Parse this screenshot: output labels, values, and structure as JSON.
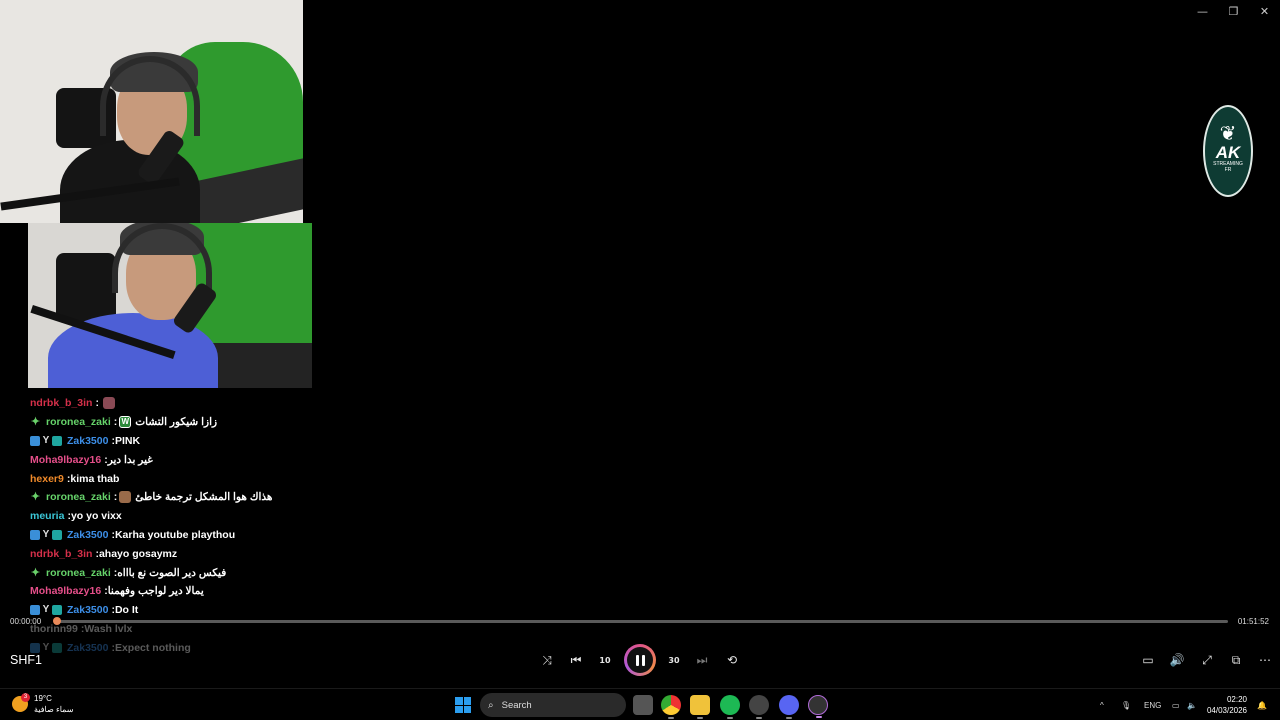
{
  "window": {
    "controls": [
      "—",
      "❐",
      "✕"
    ]
  },
  "logo": {
    "text": "AK",
    "subtext": "STREAMING\nFR"
  },
  "chat": {
    "messages": [
      {
        "user": "ndrbk_b_3in",
        "color": "#d6304a",
        "badges": [],
        "text": "",
        "emote": "pink",
        "faded": false
      },
      {
        "user": "roronea_zaki",
        "color": "#66d36a",
        "badges": [
          "star"
        ],
        "text": "زازا شيكور التشات",
        "emote": "w",
        "faded": false
      },
      {
        "user": "Zak3500",
        "color": "#3d8fe8",
        "badges": [
          "blue",
          "y",
          "cyan"
        ],
        "text": "PINK",
        "emote": "",
        "faded": false
      },
      {
        "user": "Moha9lbazy16",
        "color": "#e64f8a",
        "badges": [],
        "text": "غير بدا دير",
        "emote": "",
        "faded": false
      },
      {
        "user": "hexer9",
        "color": "#f08a2a",
        "badges": [],
        "text": "kima thab",
        "emote": "",
        "faded": false
      },
      {
        "user": "roronea_zaki",
        "color": "#66d36a",
        "badges": [
          "star"
        ],
        "text": "هذاك هوا المشكل ترجمة خاطئ",
        "emote": "cat",
        "faded": false
      },
      {
        "user": "meuria",
        "color": "#3bc6d6",
        "badges": [],
        "text": "yo yo vixx",
        "emote": "",
        "faded": false
      },
      {
        "user": "Zak3500",
        "color": "#3d8fe8",
        "badges": [
          "blue",
          "y",
          "cyan"
        ],
        "text": "Karha youtube playthou",
        "emote": "",
        "faded": false
      },
      {
        "user": "ndrbk_b_3in",
        "color": "#d6304a",
        "badges": [],
        "text": "ahayo gosaymz",
        "emote": "",
        "faded": false
      },
      {
        "user": "roronea_zaki",
        "color": "#66d36a",
        "badges": [
          "star"
        ],
        "text": "فيكس دير الصوت نع باااه",
        "emote": "",
        "faded": false
      },
      {
        "user": "Moha9lbazy16",
        "color": "#e64f8a",
        "badges": [],
        "text": "يمالا دير لواجب وفهمنا",
        "emote": "",
        "faded": false
      },
      {
        "user": "Zak3500",
        "color": "#3d8fe8",
        "badges": [
          "blue",
          "y",
          "cyan"
        ],
        "text": "Do It",
        "emote": "",
        "faded": false
      },
      {
        "user": "thorinn99",
        "color": "#ffffff",
        "badges": [],
        "text": "Wash lvlx",
        "emote": "",
        "faded": true
      },
      {
        "user": "Zak3500",
        "color": "#3d8fe8",
        "badges": [
          "blue",
          "y",
          "cyan"
        ],
        "text": "Expect nothing",
        "emote": "",
        "faded": true
      }
    ]
  },
  "player": {
    "current_time": "00:00:00",
    "total_time": "01:51:52",
    "progress": 0.002,
    "title": "SHF1",
    "controls": {
      "shuffle": "⤨",
      "previous": "⏮",
      "rewind": "10",
      "forward": "30",
      "next": "⏭",
      "repeat": "⟲"
    },
    "right_controls": {
      "subtitles": "▭",
      "volume": "🔊",
      "fullscreen": "⤢",
      "miniplayer": "⧉",
      "more": "⋯"
    }
  },
  "taskbar": {
    "weather": {
      "temp": "19°C",
      "desc": "سماء صافية",
      "badge": "3"
    },
    "search_placeholder": "Search",
    "tray": {
      "chevron": "^",
      "mic": "🎙",
      "lang": "ENG"
    },
    "clock": {
      "time": "02:20",
      "date": "04/03/2026"
    }
  },
  "colors": {
    "accent": "#e0558a",
    "seek_fill": "#c8795a",
    "green_screen": "#2f9a2e"
  }
}
